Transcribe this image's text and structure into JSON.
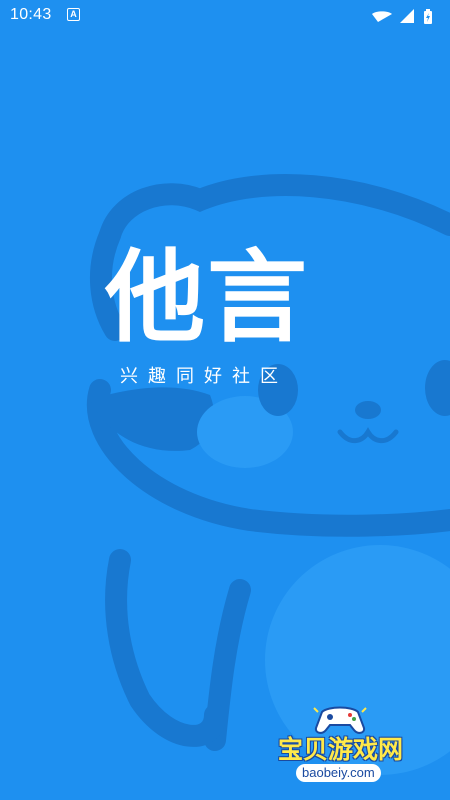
{
  "status_bar": {
    "time": "10:43",
    "notification_icon": "A"
  },
  "splash": {
    "title": "他言",
    "tagline": "兴趣同好社区"
  },
  "watermark": {
    "text": "宝贝游戏网",
    "url": "baobeiy.com"
  },
  "colors": {
    "background": "#1E90F0",
    "mascot_line": "#1878D0",
    "mascot_fill": "#2A9BF5",
    "watermark_yellow": "#FFE94A"
  },
  "icons": [
    "wifi-icon",
    "signal-icon",
    "battery-icon",
    "controller-icon"
  ]
}
